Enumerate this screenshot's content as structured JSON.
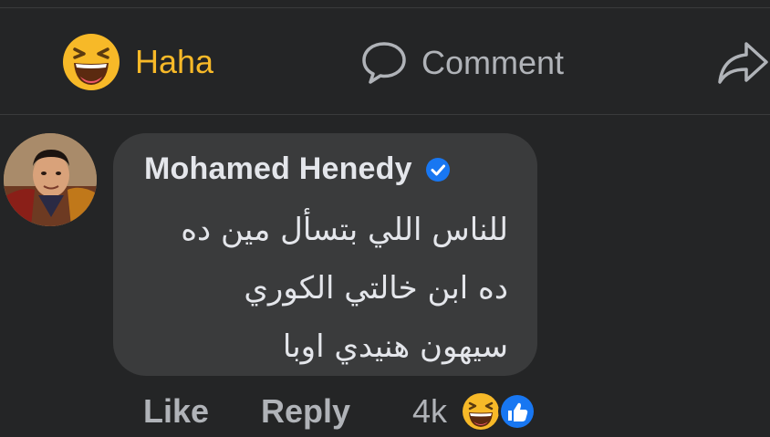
{
  "actions": {
    "haha_label": "Haha",
    "comment_label": "Comment"
  },
  "comment": {
    "author": "Mohamed Henedy",
    "verified": true,
    "lines": [
      "للناس اللي بتسأل مين ده",
      "ده ابن خالتي الكوري",
      "سيهون هنيدي اوبا"
    ],
    "like_label": "Like",
    "reply_label": "Reply",
    "reaction_count": "4k",
    "reaction_icons": [
      "haha-icon",
      "like-icon"
    ]
  },
  "colors": {
    "background": "#242526",
    "bubble": "#3a3b3c",
    "haha_accent": "#f7b928",
    "secondary_text": "#b0b3b8",
    "primary_text": "#e4e6eb",
    "verified_blue": "#1877f2"
  }
}
